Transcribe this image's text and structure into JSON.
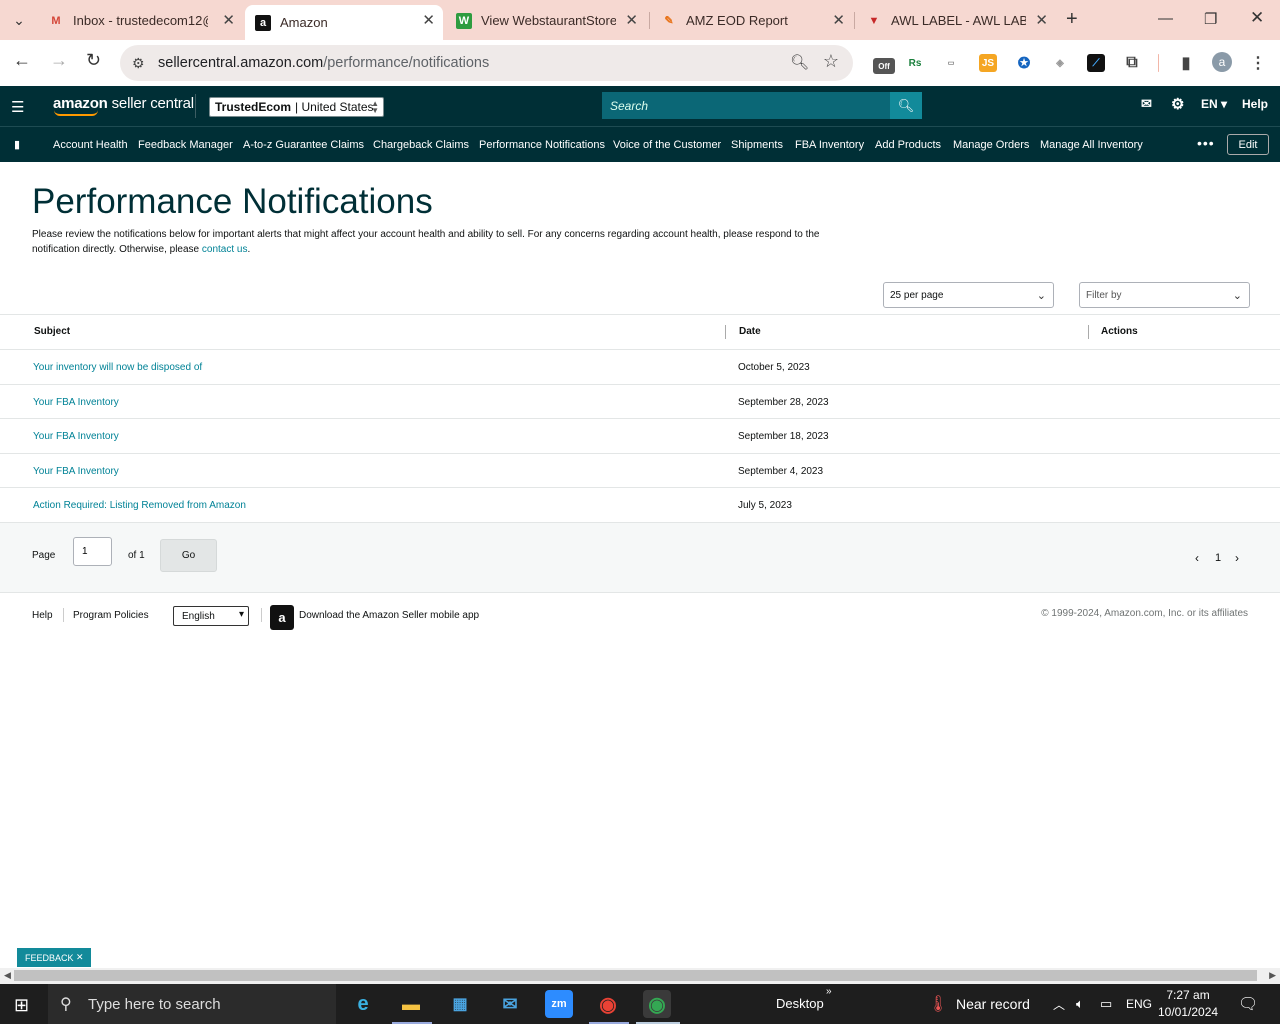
{
  "browser": {
    "tabs": [
      {
        "title": "Inbox - trustedecom12@",
        "icon": "gmail-icon"
      },
      {
        "title": "Amazon",
        "icon": "amazon-icon"
      },
      {
        "title": "View WebstaurantStore C",
        "icon": "webstaurant-icon"
      },
      {
        "title": "AMZ EOD Report",
        "icon": "report-icon"
      },
      {
        "title": "AWL LABEL - AWL LABEL",
        "icon": "awl-icon"
      }
    ],
    "url_host": "sellercentral.amazon.com",
    "url_path": "/performance/notifications",
    "profile_initial": "a",
    "ext_off_label": "Off"
  },
  "header": {
    "logo_brand": "amazon",
    "logo_suffix": "seller central",
    "store_name": "TrustedEcom",
    "store_region": "| United States",
    "search_placeholder": "Search",
    "lang": "EN",
    "help": "Help"
  },
  "nav": {
    "items": [
      "Account Health",
      "Feedback Manager",
      "A-to-z Guarantee Claims",
      "Chargeback Claims",
      "Performance Notifications",
      "Voice of the Customer",
      "Shipments",
      "FBA Inventory",
      "Add Products",
      "Manage Orders",
      "Manage All Inventory"
    ],
    "edit": "Edit"
  },
  "main": {
    "title": "Performance Notifications",
    "intro": "Please review the notifications below for important alerts that might affect your account health and ability to sell. For any concerns regarding account health, please respond to the notification directly. Otherwise, please ",
    "intro_link": "contact us",
    "per_page": "25 per page",
    "filter_placeholder": "Filter by",
    "columns": {
      "subject": "Subject",
      "date": "Date",
      "actions": "Actions"
    },
    "rows": [
      {
        "subject": "Your inventory will now be disposed of",
        "date": "October 5, 2023"
      },
      {
        "subject": "Your FBA Inventory",
        "date": "September 28, 2023"
      },
      {
        "subject": "Your FBA Inventory",
        "date": "September 18, 2023"
      },
      {
        "subject": "Your FBA Inventory",
        "date": "September 4, 2023"
      },
      {
        "subject": "Action Required: Listing Removed from Amazon",
        "date": "July 5, 2023"
      }
    ],
    "pager": {
      "page_label": "Page",
      "page_value": "1",
      "of_label": "of 1",
      "go": "Go",
      "current": "1"
    }
  },
  "footer": {
    "help": "Help",
    "policies": "Program Policies",
    "language": "English",
    "app_link": "Download the Amazon Seller mobile app",
    "copyright": "© 1999-2024, Amazon.com, Inc. or its affiliates"
  },
  "feedback_label": "FEEDBACK",
  "taskbar": {
    "search_placeholder": "Type here to search",
    "desktop": "Desktop",
    "weather": "Near record",
    "lang": "ENG",
    "time": "7:27 am",
    "date": "10/01/2024"
  },
  "colors": {
    "accent": "#008296",
    "header_bg": "#002f36",
    "tab_bg": "#f6d8d1"
  }
}
